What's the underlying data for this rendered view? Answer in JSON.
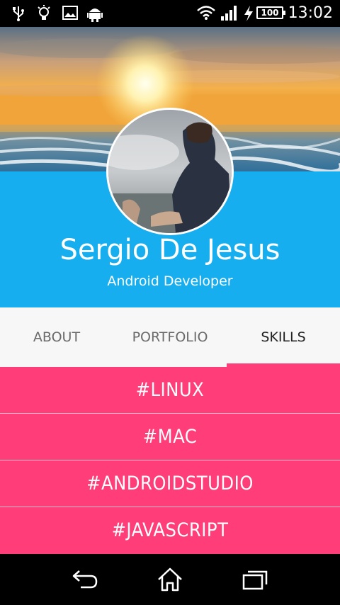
{
  "status_bar": {
    "time": "13:02",
    "battery": "100",
    "icons": [
      "usb-icon",
      "lightbulb-icon",
      "image-icon",
      "android-icon",
      "wifi-icon",
      "signal-icon",
      "charging-icon",
      "battery-icon"
    ]
  },
  "profile": {
    "name": "Sergio De Jesus",
    "role": "Android Developer"
  },
  "tabs": [
    {
      "label": "ABOUT"
    },
    {
      "label": "PORTFOLIO"
    },
    {
      "label": "SKILLS"
    }
  ],
  "active_tab": "SKILLS",
  "skills": [
    {
      "label": "#LINUX"
    },
    {
      "label": "#MAC"
    },
    {
      "label": "#ANDROIDSTUDIO"
    },
    {
      "label": "#JAVASCRIPT"
    }
  ],
  "nav_bar": {
    "icons": [
      "back-icon",
      "home-icon",
      "recents-icon"
    ]
  },
  "colors": {
    "accent_blue": "#17aeef",
    "accent_pink": "#ff3d78",
    "tab_bar": "#f7f7f7"
  }
}
